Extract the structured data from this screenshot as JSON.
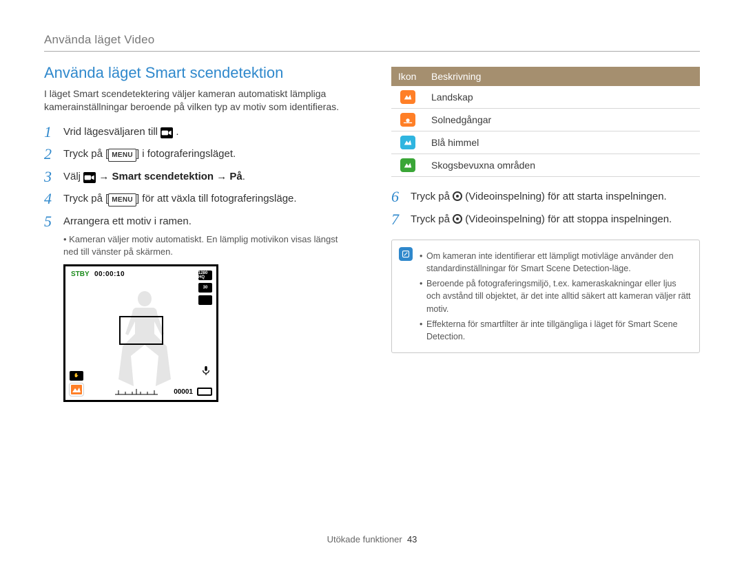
{
  "header": {
    "breadcrumb": "Använda läget Video"
  },
  "title": "Använda läget Smart scendetektion",
  "intro": "I läget Smart scendetektering väljer kameran automatiskt lämpliga kamerainställningar beroende på vilken typ av motiv som identifieras.",
  "steps_left": [
    {
      "n": "1",
      "prefix": "Vrid lägesväljaren till ",
      "icon": "video-mode",
      "suffix": "."
    },
    {
      "n": "2",
      "prefix": "Tryck på [",
      "icon": "menu",
      "suffix": "] i fotograferingsläget."
    },
    {
      "n": "3",
      "prefix": "Välj ",
      "icon": "video-mode-box",
      "bold_suffix": " → Smart scendetektion → På",
      "suffix": "."
    },
    {
      "n": "4",
      "prefix": "Tryck på [",
      "icon": "menu",
      "suffix": "] för att växla till fotograferingsläge."
    },
    {
      "n": "5",
      "prefix": "Arrangera ett motiv i ramen.",
      "sub": "Kameran väljer motiv automatiskt. En lämplig motivikon visas längst ned till vänster på skärmen."
    }
  ],
  "screen": {
    "stby": "STBY",
    "time": "00:00:10",
    "right_badges": [
      "1280 HQ",
      "30",
      ""
    ],
    "counter": "00001"
  },
  "steps_right": [
    {
      "n": "6",
      "prefix": "Tryck på ",
      "icon": "record",
      "suffix": " (Videoinspelning) för att starta inspelningen."
    },
    {
      "n": "7",
      "prefix": "Tryck på ",
      "icon": "record",
      "suffix": " (Videoinspelning) för att stoppa inspelningen."
    }
  ],
  "table": {
    "headers": [
      "Ikon",
      "Beskrivning"
    ],
    "rows": [
      {
        "color": "#ff7f27",
        "svg": "mountain",
        "label": "Landskap"
      },
      {
        "color": "#ff7f27",
        "svg": "sunset",
        "label": "Solnedgångar"
      },
      {
        "color": "#2fb5e0",
        "svg": "sky",
        "label": "Blå himmel"
      },
      {
        "color": "#3aa637",
        "svg": "forest",
        "label": "Skogsbevuxna områden"
      }
    ]
  },
  "notes": [
    "Om kameran inte identifierar ett lämpligt motivläge använder den standardinställningar för Smart Scene Detection-läge.",
    "Beroende på fotograferingsmiljö, t.ex. kameraskakningar eller ljus och avstånd till objektet, är det inte alltid säkert att kameran väljer rätt motiv.",
    "Effekterna för smartfilter är inte tillgängliga i läget för Smart Scene Detection."
  ],
  "footer": {
    "section": "Utökade funktioner",
    "page": "43"
  }
}
